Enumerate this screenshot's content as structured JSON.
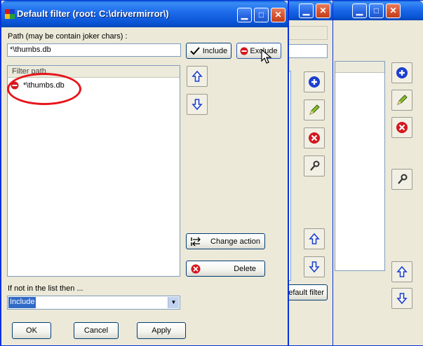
{
  "main_window": {
    "title": "Default filter (root: C:\\drivermirror\\)",
    "path_label": "Path (may be contain joker chars) :",
    "path_value": "*\\thumbs.db",
    "include_label": "Include",
    "exclude_label": "Exclude",
    "list_header": "Filter path",
    "list_items": [
      {
        "text": "*\\thumbs.db",
        "action": "exclude"
      }
    ],
    "change_action_label": "Change action",
    "delete_label": "Delete",
    "fallback_label": "If not in the list then ...",
    "fallback_value": "Include",
    "ok_label": "OK",
    "cancel_label": "Cancel",
    "apply_label": "Apply"
  },
  "back_window": {
    "default_filter_label": "efault filter"
  },
  "colors": {
    "accent_blue": "#0a5fd7",
    "exclude_red": "#d4171e",
    "highlight_circle": "#e8141b"
  }
}
